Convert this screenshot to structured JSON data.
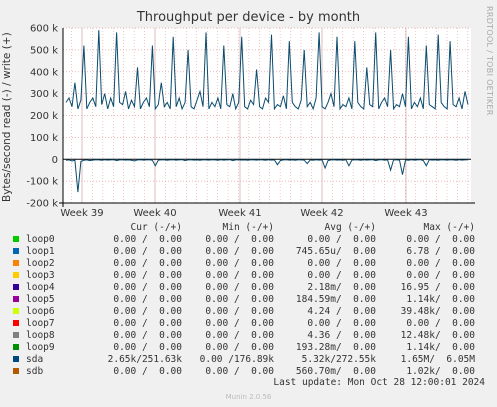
{
  "chart_data": {
    "type": "line",
    "title": "Throughput per device - by month",
    "ylabel": "Bytes/second read (-) / write (+)",
    "side_label": "RRDTOOL / TOBI OETIKER",
    "ylim": [
      -200000,
      600000
    ],
    "y_ticks": [
      "600 k",
      "500 k",
      "400 k",
      "300 k",
      "200 k",
      "100 k",
      "0",
      "-100 k",
      "-200 k"
    ],
    "x_ticks": [
      "Week 39",
      "Week 40",
      "Week 41",
      "Week 42",
      "Week 43"
    ],
    "series": [
      {
        "name": "sda",
        "color": "#0b4c6e",
        "write_values": [
          260000,
          280000,
          240000,
          350000,
          230000,
          270000,
          520000,
          230000,
          260000,
          280000,
          240000,
          590000,
          250000,
          300000,
          230000,
          280000,
          240000,
          580000,
          260000,
          250000,
          310000,
          230000,
          270000,
          240000,
          420000,
          230000,
          260000,
          280000,
          240000,
          520000,
          230000,
          250000,
          350000,
          240000,
          260000,
          230000,
          560000,
          240000,
          280000,
          230000,
          260000,
          500000,
          240000,
          230000,
          270000,
          310000,
          240000,
          580000,
          230000,
          260000,
          240000,
          280000,
          230000,
          520000,
          250000,
          240000,
          300000,
          230000,
          260000,
          560000,
          240000,
          230000,
          270000,
          250000,
          410000,
          240000,
          230000,
          280000,
          260000,
          570000,
          230000,
          250000,
          240000,
          290000,
          230000,
          540000,
          260000,
          240000,
          230000,
          270000,
          500000,
          240000,
          260000,
          230000,
          280000,
          580000,
          240000,
          230000,
          260000,
          300000,
          240000,
          560000,
          230000,
          250000,
          240000,
          280000,
          230000,
          540000,
          260000,
          240000,
          230000,
          420000,
          250000,
          240000,
          580000,
          230000,
          260000,
          280000,
          240000,
          500000,
          230000,
          250000,
          240000,
          300000,
          240000,
          560000,
          230000,
          260000,
          240000,
          280000,
          230000,
          520000,
          250000,
          240000,
          230000,
          570000,
          260000,
          240000,
          230000,
          540000,
          250000,
          240000,
          280000,
          230000,
          310000,
          250000
        ],
        "read_values": [
          -5000,
          -3000,
          -8000,
          -4000,
          -150000,
          -10000,
          -5000,
          -3000,
          -6000,
          -4000,
          -2000,
          -3000,
          -5000,
          -2000,
          -4000,
          -3000,
          -2000,
          -6000,
          -3000,
          -2000,
          -4000,
          -3000,
          -5000,
          -8000,
          -3000,
          -2000,
          -4000,
          -3000,
          -2000,
          -5000,
          -30000,
          -4000,
          -3000,
          -2000,
          -5000,
          -3000,
          -2000,
          -4000,
          -3000,
          -2000,
          -6000,
          -3000,
          -2000,
          -4000,
          -3000,
          -5000,
          -2000,
          -3000,
          -4000,
          -2000,
          -3000,
          -5000,
          -2000,
          -4000,
          -3000,
          -2000,
          -6000,
          -3000,
          -2000,
          -4000,
          -3000,
          -5000,
          -2000,
          -3000,
          -4000,
          -2000,
          -3000,
          -5000,
          -2000,
          -4000,
          -3000,
          -25000,
          -6000,
          -3000,
          -2000,
          -4000,
          -3000,
          -5000,
          -2000,
          -3000,
          -4000,
          -20000,
          -3000,
          -5000,
          -2000,
          -4000,
          -3000,
          -40000,
          -6000,
          -3000,
          -2000,
          -4000,
          -3000,
          -5000,
          -2000,
          -30000,
          -4000,
          -2000,
          -3000,
          -5000,
          -2000,
          -4000,
          -3000,
          -2000,
          -6000,
          -3000,
          -2000,
          -4000,
          -3000,
          -50000,
          -2000,
          -3000,
          -4000,
          -70000,
          -3000,
          -5000,
          -2000,
          -4000,
          -3000,
          -2000,
          -6000,
          -30000,
          -2000,
          -4000,
          -3000,
          -5000,
          -2000,
          -3000,
          -4000,
          -2000,
          -3000,
          -5000,
          -2000,
          -4000,
          -3000,
          -2000
        ]
      }
    ],
    "grid": true
  },
  "legend": {
    "headers": {
      "cur": "Cur (-/+)",
      "min": "Min (-/+)",
      "avg": "Avg (-/+)",
      "max": "Max (-/+)"
    },
    "rows": [
      {
        "name": "loop0",
        "color": "#00cc00",
        "cur": "0.00 /  0.00",
        "min": "0.00 /  0.00",
        "avg": "0.00 /  0.00",
        "max": "0.00 /  0.00"
      },
      {
        "name": "loop1",
        "color": "#0066b3",
        "cur": "0.00 /  0.00",
        "min": "0.00 /  0.00",
        "avg": "745.65u/  0.00",
        "max": "6.78 /  0.00"
      },
      {
        "name": "loop2",
        "color": "#ff8000",
        "cur": "0.00 /  0.00",
        "min": "0.00 /  0.00",
        "avg": "0.00 /  0.00",
        "max": "0.00 /  0.00"
      },
      {
        "name": "loop3",
        "color": "#ffcc00",
        "cur": "0.00 /  0.00",
        "min": "0.00 /  0.00",
        "avg": "0.00 /  0.00",
        "max": "0.00 /  0.00"
      },
      {
        "name": "loop4",
        "color": "#330099",
        "cur": "0.00 /  0.00",
        "min": "0.00 /  0.00",
        "avg": "2.18m/  0.00",
        "max": "16.95 /  0.00"
      },
      {
        "name": "loop5",
        "color": "#990099",
        "cur": "0.00 /  0.00",
        "min": "0.00 /  0.00",
        "avg": "184.59m/  0.00",
        "max": "1.14k/  0.00"
      },
      {
        "name": "loop6",
        "color": "#ccff00",
        "cur": "0.00 /  0.00",
        "min": "0.00 /  0.00",
        "avg": "4.24 /  0.00",
        "max": "39.48k/  0.00"
      },
      {
        "name": "loop7",
        "color": "#ff0000",
        "cur": "0.00 /  0.00",
        "min": "0.00 /  0.00",
        "avg": "0.00 /  0.00",
        "max": "0.00 /  0.00"
      },
      {
        "name": "loop8",
        "color": "#808080",
        "cur": "0.00 /  0.00",
        "min": "0.00 /  0.00",
        "avg": "4.36 /  0.00",
        "max": "12.48k/  0.00"
      },
      {
        "name": "loop9",
        "color": "#008f00",
        "cur": "0.00 /  0.00",
        "min": "0.00 /  0.00",
        "avg": "193.28m/  0.00",
        "max": "1.14k/  0.00"
      },
      {
        "name": "sda",
        "color": "#00487d",
        "cur": "2.65k/251.63k",
        "min": "0.00 /176.89k",
        "avg": "5.32k/272.55k",
        "max": "1.65M/  6.05M"
      },
      {
        "name": "sdb",
        "color": "#b35a00",
        "cur": "0.00 /  0.00",
        "min": "0.00 /  0.00",
        "avg": "560.70m/  0.00",
        "max": "1.02k/  0.00"
      }
    ]
  },
  "footer": "Last update: Mon Oct 28 12:00:01 2024",
  "credit": "Munin 2.0.56"
}
